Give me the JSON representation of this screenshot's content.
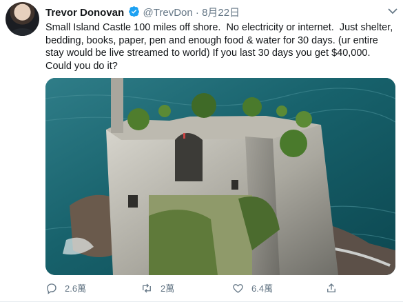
{
  "tweet": {
    "author_name": "Trevor Donovan",
    "handle": "@TrevDon",
    "separator": "·",
    "date": "8月22日",
    "text": "Small Island Castle 100 miles off shore.  No electricity or internet.  Just shelter, bedding, books, paper, pen and enough food & water for 30 days. (ur entire stay would be live streamed to world) If you last 30 days you get $40,000.  Could you do it?",
    "actions": {
      "reply_count": "2.6萬",
      "retweet_count": "2萬",
      "like_count": "6.4萬"
    }
  },
  "colors": {
    "verified_blue": "#1da1f2",
    "secondary_text": "#657786",
    "sea": "#1b6470"
  },
  "icons": [
    "verified-badge-icon",
    "chevron-down-icon",
    "reply-icon",
    "retweet-icon",
    "like-icon",
    "share-icon"
  ]
}
